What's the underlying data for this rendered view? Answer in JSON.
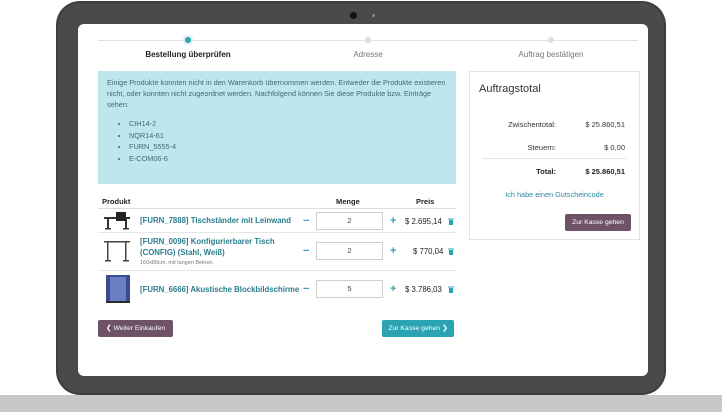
{
  "steps": [
    {
      "label": "Bestellung überprüfen",
      "active": true
    },
    {
      "label": "Adresse",
      "active": false
    },
    {
      "label": "Auftrag bestätigen",
      "active": false
    }
  ],
  "alert": {
    "message": "Einige Produkte konnten nicht in den Warenkorb übernommen werden. Entweder die Produkte existieren nicht, oder konnten nicht zugeordnet werden. Nachfolgend können Sie diese Produkte bzw. Einträge sehen:",
    "items": [
      "CIH14-2",
      "NQR14-61",
      "FURN_5555-4",
      "E-COM06-6"
    ]
  },
  "table": {
    "headers": {
      "product": "Produkt",
      "quantity": "Menge",
      "price": "Preis"
    },
    "rows": [
      {
        "name": "[FURN_7888] Tischständer mit Leinwand",
        "description": "",
        "quantity": "2",
        "price": "$ 2.695,14",
        "icon": "desk-with-screen-icon"
      },
      {
        "name": "[FURN_0096] Konfigurierbarer Tisch (CONFIG) (Stahl, Weiß)",
        "description": "160x80cm, mit langen Beinen.",
        "quantity": "2",
        "price": "$ 770,04",
        "icon": "desk-icon"
      },
      {
        "name": "[FURN_6666] Akustische Blockbildschirme",
        "description": "",
        "quantity": "5",
        "price": "$ 3.786,03",
        "icon": "acoustic-screen-icon"
      }
    ]
  },
  "buttons": {
    "continue_shopping": "Weiter Einkaufen",
    "checkout": "Zur Kasse gehen"
  },
  "summary": {
    "title": "Auftragstotal",
    "subtotal_label": "Zwischentotal:",
    "subtotal_value": "$ 25.860,51",
    "tax_label": "Steuern:",
    "tax_value": "$ 0,00",
    "total_label": "Total:",
    "total_value": "$ 25.860,51",
    "coupon_link": "Ich habe einen Gutscheincode",
    "checkout_button": "Zur Kasse gehen"
  },
  "colors": {
    "accent": "#2ba3b3",
    "primary": "#6e5366",
    "alert_bg": "#bfe6ec"
  }
}
